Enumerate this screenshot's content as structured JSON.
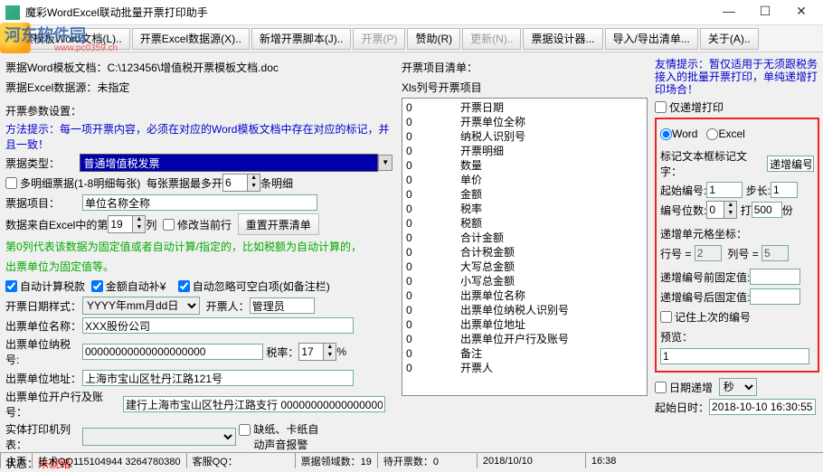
{
  "window": {
    "title": "魔彩WordExcel联动批量开票打印助手",
    "min": "—",
    "max": "☐",
    "close": "✕"
  },
  "watermark": {
    "line1": "河东软件园",
    "line2": "www.pc0359.cn"
  },
  "toolbar": {
    "b1": "新票模板Word文档(L)..",
    "b2": "开票Excel数据源(X)..",
    "b3": "新增开票脚本(J)..",
    "b4": "开票(P)",
    "b5": "赞助(R)",
    "b6": "更新(N)..",
    "b7": "票据设计器...",
    "b8": "导入/导出清单...",
    "b9": "关于(A).."
  },
  "paths": {
    "l1": "票据Word模板文档：",
    "v1": "C:\\123456\\增值税开票模板文档.doc",
    "l2": "票据Excel数据源：",
    "v2": "未指定"
  },
  "params": {
    "title": "开票参数设置：",
    "hint": "方法提示：每一项开票内容，必须在对应的Word模板文档中存在对应的标记，并且一致！"
  },
  "type": {
    "label": "票据类型：",
    "value": "普通增值税发票"
  },
  "detail": {
    "cb1": "多明细票据(1-8明细每张)",
    "lbl2": "每张票据最多开",
    "val2": "6",
    "lbl3": "条明细"
  },
  "item": {
    "label": "票据项目：",
    "value": "单位名称全称"
  },
  "datarow": {
    "l1": "数据来自Excel中的第",
    "v1": "19",
    "l2": "列",
    "cb": "修改当前行",
    "btn": "重置开票清单"
  },
  "note": {
    "l1": "第0列代表该数据为固定值或者自动计算/指定的，比如税额为自动计算的，",
    "l2": "出票单位为固定值等。"
  },
  "auto": {
    "cb1": "自动计算税款",
    "cb2": "金额自动补¥",
    "cb3": "自动忽略可空白项(如备注栏)"
  },
  "dateformat": {
    "label": "开票日期样式：",
    "value": "YYYY年mm月dd日",
    "l2": "开票人：",
    "v2": "管理员"
  },
  "company": {
    "label": "出票单位名称：",
    "value": "XXX股份公司"
  },
  "taxid": {
    "label": "出票单位纳税号:",
    "value": "00000000000000000000",
    "rlabel": "税率：",
    "rvalue": "17",
    "pct": "%"
  },
  "addr": {
    "label": "出票单位地址：",
    "value": "上海市宝山区牡丹江路121号"
  },
  "bank": {
    "label": "出票单位开户行及账号：",
    "value": "建行上海市宝山区牡丹江路支行 00000000000000000"
  },
  "printer": {
    "label": "实体打印机列表：",
    "cb1": "缺纸、卡纸自",
    "cb2": "动声音报警"
  },
  "status": {
    "label": "状态：",
    "value": "未就绪"
  },
  "mid": {
    "title": "开票项目清单：",
    "col1": "Xls列号",
    "col2": "开票项目",
    "items": [
      [
        "0",
        "开票日期"
      ],
      [
        "0",
        "开票单位全称"
      ],
      [
        "0",
        "纳税人识别号"
      ],
      [
        "0",
        "开票明细"
      ],
      [
        "0",
        "数量"
      ],
      [
        "0",
        "单价"
      ],
      [
        "0",
        "金额"
      ],
      [
        "0",
        "税率"
      ],
      [
        "0",
        "税额"
      ],
      [
        "0",
        "合计金额"
      ],
      [
        "0",
        "合计税金额"
      ],
      [
        "0",
        "大写总金额"
      ],
      [
        "0",
        "小写总金额"
      ],
      [
        "0",
        "出票单位名称"
      ],
      [
        "0",
        "出票单位纳税人识别号"
      ],
      [
        "0",
        "出票单位地址"
      ],
      [
        "0",
        "出票单位开户行及账号"
      ],
      [
        "0",
        "备注"
      ],
      [
        "0",
        "开票人"
      ]
    ]
  },
  "right": {
    "tip": "友情提示：暂仅适用于无须跟税务接入的批量开票打印，单纯递增打印场合！",
    "cbOnly": "仅递增打印",
    "rWord": "Word",
    "rExcel": "Excel",
    "markLbl": "标记文本框标记文字：",
    "markVal": "递增编号",
    "startLbl": "起始编号:",
    "startVal": "1",
    "stepLbl": "步长:",
    "stepVal": "1",
    "digitsLbl": "编号位数:",
    "digitsVal": "0",
    "printLbl": "打",
    "printVal": "500",
    "printSuffix": "份",
    "cellLbl": "递增单元格坐标：",
    "rowLbl": "行号 =",
    "rowVal": "2",
    "colLbl": "列号 =",
    "colVal": "5",
    "preLbl": "递增编号前固定值:",
    "preVal": "",
    "sufLbl": "递增编号后固定值:",
    "sufVal": "",
    "remember": "记住上次的编号",
    "prevLbl": "预览：",
    "prevVal": "1",
    "dateCb": "日期递增",
    "dateUnit": "秒",
    "dateLbl": "起始日时：",
    "dateVal": "2018-10-10 16:30:55"
  },
  "statusbar": {
    "s1": "主页",
    "s2": "技术QQ115104944 3264780380",
    "s3": "客服QQ：",
    "s4": "票据领域数：19",
    "s5": "待开票数：0",
    "s6": "2018/10/10",
    "s7": "16:38"
  }
}
